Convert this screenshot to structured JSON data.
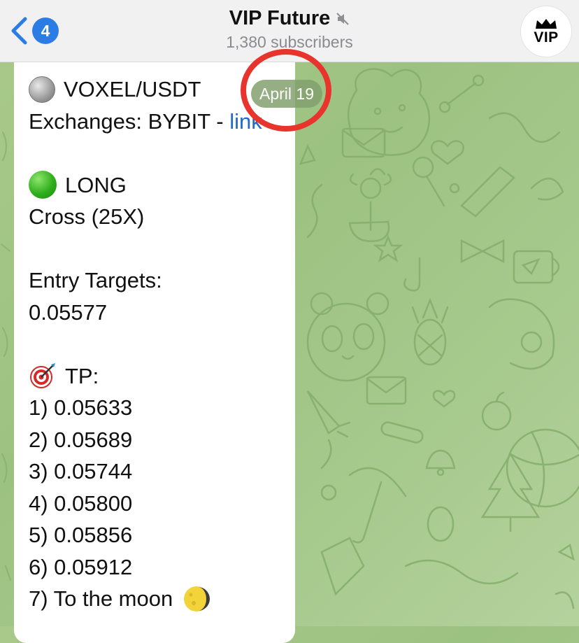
{
  "header": {
    "back_badge": "4",
    "title": "VIP Future",
    "subtitle": "1,380 subscribers",
    "avatar_text": "VIP"
  },
  "date_pill": "April 19",
  "message": {
    "pair": "VOXEL/USDT",
    "exchanges_prefix": "Exchanges: BYBIT - ",
    "exchanges_link": "link",
    "direction": "LONG",
    "leverage": "Cross (25X)",
    "entry_label": "Entry Targets:",
    "entry_value": "0.05577",
    "tp_label": "TP:",
    "tp": [
      "1) 0.05633",
      "2) 0.05689",
      "3) 0.05744",
      "4) 0.05800",
      "5) 0.05856",
      "6) 0.05912",
      "7) To the moon"
    ]
  },
  "colors": {
    "accent": "#2c7ce6",
    "link": "#2468c9",
    "highlight_circle": "#e8342c",
    "chat_background": "#a6c98d"
  },
  "icons": {
    "back": "chevron-left-icon",
    "mute": "speaker-muted-icon",
    "coin": "silver-coin-emoji",
    "long": "green-circle-emoji",
    "tp": "direct-hit-emoji",
    "moon": "moon-emoji"
  }
}
